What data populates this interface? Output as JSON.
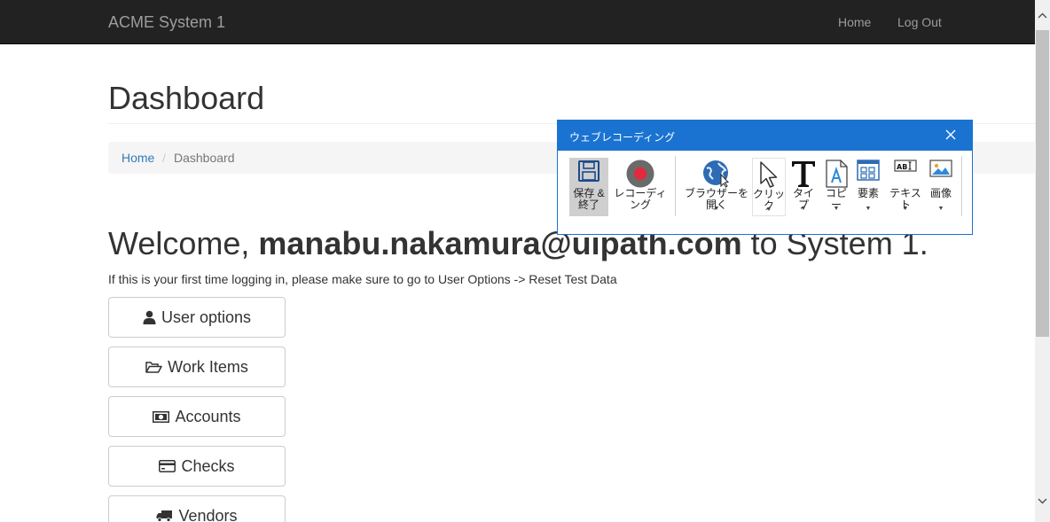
{
  "navbar": {
    "brand": "ACME System 1",
    "links": [
      {
        "label": "Home"
      },
      {
        "label": "Log Out"
      }
    ]
  },
  "page": {
    "title": "Dashboard",
    "breadcrumb": {
      "home": "Home",
      "separator": "/",
      "current": "Dashboard"
    },
    "welcome": {
      "prefix": "Welcome, ",
      "user": "manabu.nakamura@uipath.com",
      "suffix": " to System 1."
    },
    "hint": "If this is your first time logging in, please make sure to go to User Options -> Reset Test Data",
    "menu_buttons": [
      {
        "label": "User options",
        "icon": "user-icon"
      },
      {
        "label": "Work Items",
        "icon": "folder-open-icon"
      },
      {
        "label": "Accounts",
        "icon": "money-icon"
      },
      {
        "label": "Checks",
        "icon": "credit-card-icon"
      },
      {
        "label": "Vendors",
        "icon": "truck-icon"
      }
    ]
  },
  "recorder": {
    "title": "ウェブレコーディング",
    "tools": {
      "save_line1": "保存 &",
      "save_line2": "終了",
      "record": "レコーディング",
      "browser": "ブラウザーを開く",
      "click": "クリック",
      "type": "タイプ",
      "copy": "コピー",
      "element": "要素",
      "text": "テキスト",
      "image": "画像"
    }
  },
  "colors": {
    "navbar_bg": "#222222",
    "link": "#337ab7",
    "recorder_accent": "#1a73d1",
    "record_red": "#e5283c"
  }
}
